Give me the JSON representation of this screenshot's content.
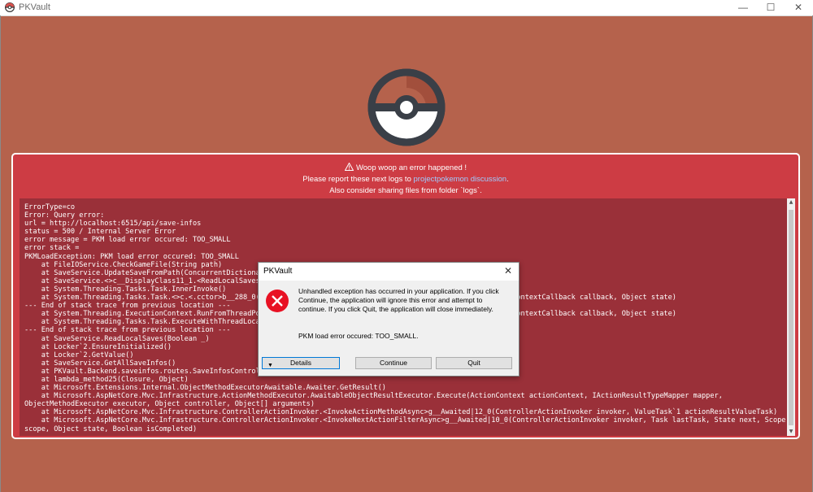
{
  "window": {
    "title": "PKVault",
    "minimize_glyph": "—",
    "maximize_glyph": "☐",
    "close_glyph": "✕"
  },
  "error_panel": {
    "headline": "Woop woop an error happened !",
    "report_prefix": "Please report these next logs to ",
    "report_link": "projectpokemon discussion",
    "report_suffix": ".",
    "sharing_note": "Also consider sharing files from folder `logs`.",
    "log_lines": [
      "ErrorType=co",
      "Error: Query error:",
      "url = http://localhost:6515/api/save-infos",
      "status = 500 / Internal Server Error",
      "error message = PKM load error occured: TOO_SMALL",
      "error stack =",
      "PKMLoadException: PKM load error occured: TOO_SMALL",
      "    at FileIOService.CheckGameFile(String path)",
      "    at SaveService.UpdateSaveFromPath(ConcurrentDictionary",
      "    at SaveService.<>c__DisplayClass11_1.<ReadLocalSaves>",
      "    at System.Threading.Tasks.Task.InnerInvoke()",
      "    at System.Threading.Tasks.Task.<>c.<.cctor>b__288_0(O                                               ionContext, ContextCallback callback, Object state)",
      "--- End of stack trace from previous location ---",
      "    at System.Threading.ExecutionContext.RunFromThreadPoo                                               ionContext, ContextCallback callback, Object state)",
      "    at System.Threading.Tasks.Task.ExecuteWithThreadLocal",
      "--- End of stack trace from previous location ---",
      "    at SaveService.ReadLocalSaves(Boolean _)",
      "    at Locker`2.EnsureInitialized()",
      "    at Locker`2.GetValue()",
      "    at SaveService.GetAllSaveInfos()",
      "    at PKVault.Backend.saveinfos.routes.SaveInfosController.GetAll()",
      "    at lambda_method25(Closure, Object)",
      "    at Microsoft.Extensions.Internal.ObjectMethodExecutorAwaitable.Awaiter.GetResult()",
      "    at Microsoft.AspNetCore.Mvc.Infrastructure.ActionMethodExecutor.AwaitableObjectResultExecutor.Execute(ActionContext actionContext, IActionResultTypeMapper mapper,",
      "ObjectMethodExecutor executor, Object controller, Object[] arguments)",
      "    at Microsoft.AspNetCore.Mvc.Infrastructure.ControllerActionInvoker.<InvokeActionMethodAsync>g__Awaited|12_0(ControllerActionInvoker invoker, ValueTask`1 actionResultValueTask)",
      "    at Microsoft.AspNetCore.Mvc.Infrastructure.ControllerActionInvoker.<InvokeNextActionFilterAsync>g__Awaited|10_0(ControllerActionInvoker invoker, Task lastTask, State next, Scope",
      "scope, Object state, Boolean isCompleted)"
    ]
  },
  "dialog": {
    "title": "PKVault",
    "close_glyph": "✕",
    "message": "Unhandled exception has occurred in your application. If you click Continue, the application will ignore this error and attempt to continue. If you click Quit, the application will close immediately.",
    "detail": "PKM load error occured: TOO_SMALL.",
    "details_button": "Details",
    "details_glyph": "▼",
    "continue_button": "Continue",
    "quit_button": "Quit"
  },
  "scrollbar": {
    "up_glyph": "▲",
    "down_glyph": "▼"
  },
  "colors": {
    "background": "#b5624c",
    "panel": "#cd3c44",
    "log_background": "#9a3039",
    "link": "#9ecbff",
    "error_icon": "#e81123"
  }
}
